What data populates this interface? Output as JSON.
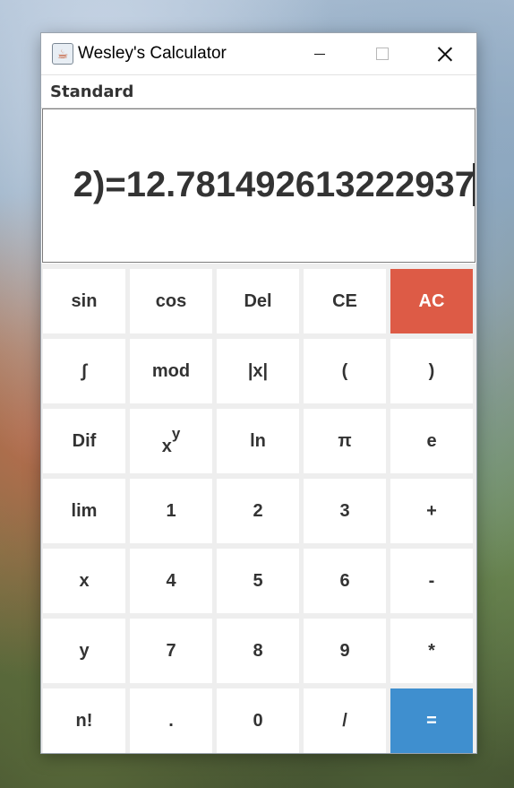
{
  "window": {
    "title": "Wesley's Calculator",
    "icon": "java-cup-icon"
  },
  "menu": {
    "mode": "Standard"
  },
  "display": {
    "text": "2)=12.781492613222937"
  },
  "keypad": {
    "rows": [
      [
        {
          "label": "sin",
          "name": "sin-button"
        },
        {
          "label": "cos",
          "name": "cos-button"
        },
        {
          "label": "Del",
          "name": "delete-button"
        },
        {
          "label": "CE",
          "name": "clear-entry-button"
        },
        {
          "label": "AC",
          "name": "all-clear-button",
          "style": "ac"
        }
      ],
      [
        {
          "label": "∫",
          "name": "integral-button"
        },
        {
          "label": "mod",
          "name": "mod-button"
        },
        {
          "label": "|x|",
          "name": "absolute-value-button"
        },
        {
          "label": "(",
          "name": "open-paren-button"
        },
        {
          "label": ")",
          "name": "close-paren-button"
        }
      ],
      [
        {
          "label": "Dif",
          "name": "differentiate-button"
        },
        {
          "label": "xy",
          "base": "x",
          "exp": "y",
          "name": "power-button"
        },
        {
          "label": "ln",
          "name": "ln-button"
        },
        {
          "label": "π",
          "name": "pi-button"
        },
        {
          "label": "e",
          "name": "e-button"
        }
      ],
      [
        {
          "label": "lim",
          "name": "limit-button"
        },
        {
          "label": "1",
          "name": "digit-1-button"
        },
        {
          "label": "2",
          "name": "digit-2-button"
        },
        {
          "label": "3",
          "name": "digit-3-button"
        },
        {
          "label": "+",
          "name": "plus-button"
        }
      ],
      [
        {
          "label": "x",
          "name": "variable-x-button"
        },
        {
          "label": "4",
          "name": "digit-4-button"
        },
        {
          "label": "5",
          "name": "digit-5-button"
        },
        {
          "label": "6",
          "name": "digit-6-button"
        },
        {
          "label": "-",
          "name": "minus-button"
        }
      ],
      [
        {
          "label": "y",
          "name": "variable-y-button"
        },
        {
          "label": "7",
          "name": "digit-7-button"
        },
        {
          "label": "8",
          "name": "digit-8-button"
        },
        {
          "label": "9",
          "name": "digit-9-button"
        },
        {
          "label": "*",
          "name": "multiply-button"
        }
      ],
      [
        {
          "label": "n!",
          "name": "factorial-button"
        },
        {
          "label": ".",
          "name": "decimal-point-button"
        },
        {
          "label": "0",
          "name": "digit-0-button"
        },
        {
          "label": "/",
          "name": "divide-button"
        },
        {
          "label": "=",
          "name": "equals-button",
          "style": "eq"
        }
      ]
    ]
  },
  "colors": {
    "ac_button": "#dd5b46",
    "equals_button": "#3f8fcf",
    "key_text": "#333333",
    "pad_background": "#eeeeee"
  }
}
